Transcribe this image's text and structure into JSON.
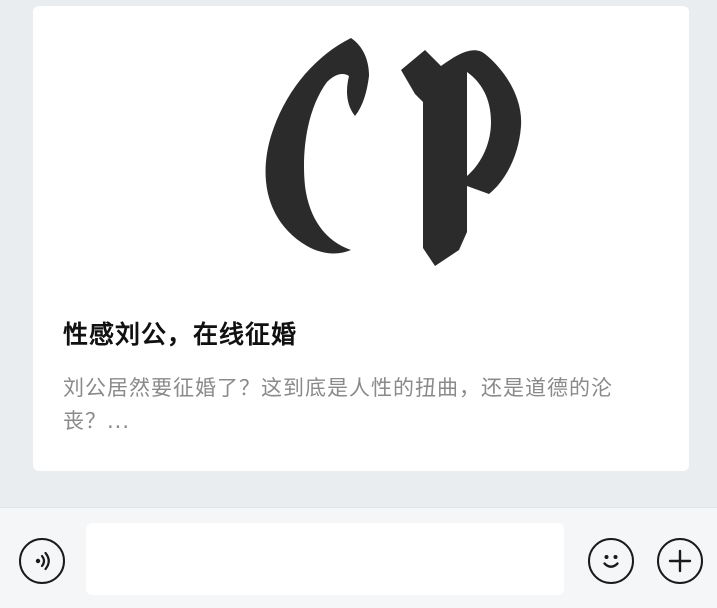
{
  "article_card": {
    "logo_text": "CP",
    "title": "性感刘公，在线征婚",
    "description": "刘公居然要征婚了？这到底是人性的扭曲，还是道德的沦丧？..."
  },
  "input_bar": {
    "message_input_value": "",
    "icons": [
      "voice-icon",
      "emoji-icon",
      "plus-icon"
    ]
  }
}
